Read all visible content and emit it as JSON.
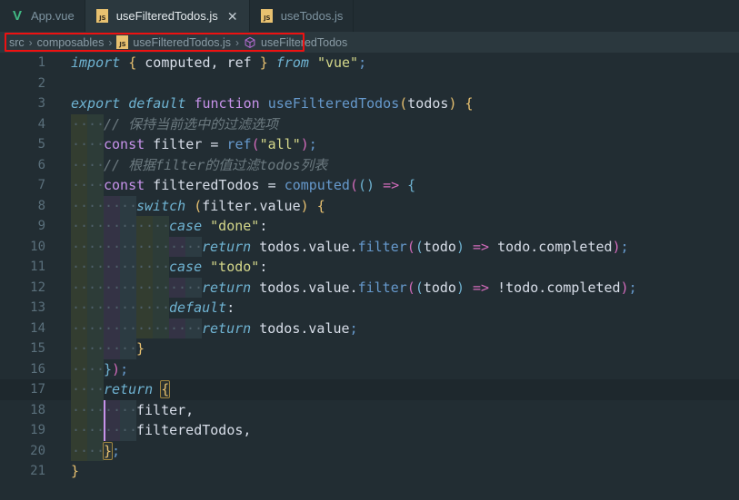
{
  "window": {
    "theme_bg": "#222d33",
    "editor_bg": "#222d33",
    "active_tab_bg": "#2b383e",
    "highlight_box_color": "#ee1111"
  },
  "tabbar": {
    "tabs": [
      {
        "label": "App.vue",
        "icon": "vue-file-icon",
        "active": false,
        "closable": false
      },
      {
        "label": "useFilteredTodos.js",
        "icon": "js-file-icon",
        "active": true,
        "closable": true,
        "close_glyph": "✕"
      },
      {
        "label": "useTodos.js",
        "icon": "js-file-icon",
        "active": false,
        "closable": false
      }
    ],
    "js_badge_text": "JS"
  },
  "breadcrumb": {
    "separator": "›",
    "items": [
      {
        "label": "src",
        "icon": ""
      },
      {
        "label": "composables",
        "icon": ""
      },
      {
        "label": "useFilteredTodos.js",
        "icon": "js-file-icon"
      },
      {
        "label": "useFilteredTodos",
        "icon": "symbol-cube-icon"
      }
    ],
    "highlight_note": "red-annotation-box"
  },
  "editor": {
    "language": "javascript",
    "file": "useFilteredTodos.js",
    "current_line": 17,
    "line_numbers": [
      1,
      2,
      3,
      4,
      5,
      6,
      7,
      8,
      9,
      10,
      11,
      12,
      13,
      14,
      15,
      16,
      17,
      18,
      19,
      20,
      21
    ],
    "lines": [
      {
        "n": 1,
        "text": "import { computed, ref } from \"vue\";"
      },
      {
        "n": 2,
        "text": ""
      },
      {
        "n": 3,
        "text": "export default function useFilteredTodos(todos) {"
      },
      {
        "n": 4,
        "text": "  // 保持当前选中的过滤选项"
      },
      {
        "n": 5,
        "text": "  const filter = ref(\"all\");"
      },
      {
        "n": 6,
        "text": "  // 根据filter的值过滤todos列表"
      },
      {
        "n": 7,
        "text": "  const filteredTodos = computed(() => {"
      },
      {
        "n": 8,
        "text": "    switch (filter.value) {"
      },
      {
        "n": 9,
        "text": "      case \"done\":"
      },
      {
        "n": 10,
        "text": "        return todos.value.filter((todo) => todo.completed);"
      },
      {
        "n": 11,
        "text": "      case \"todo\":"
      },
      {
        "n": 12,
        "text": "        return todos.value.filter((todo) => !todo.completed);"
      },
      {
        "n": 13,
        "text": "      default:"
      },
      {
        "n": 14,
        "text": "        return todos.value;"
      },
      {
        "n": 15,
        "text": "    }"
      },
      {
        "n": 16,
        "text": "  });"
      },
      {
        "n": 17,
        "text": "  return {"
      },
      {
        "n": 18,
        "text": "    filter,"
      },
      {
        "n": 19,
        "text": "    filteredTodos,"
      },
      {
        "n": 20,
        "text": "  };"
      },
      {
        "n": 21,
        "text": "}"
      }
    ],
    "comments": [
      "// 保持当前选中的过滤选项",
      "// 根据filter的值过滤todos列表"
    ],
    "strings": [
      "\"vue\"",
      "\"all\"",
      "\"done\"",
      "\"todo\""
    ],
    "identifiers": [
      "computed",
      "ref",
      "useFilteredTodos",
      "todos",
      "filter",
      "filteredTodos",
      "todo",
      "completed",
      "value",
      "switch",
      "case",
      "default",
      "return",
      "const",
      "function",
      "export",
      "import",
      "from"
    ]
  }
}
